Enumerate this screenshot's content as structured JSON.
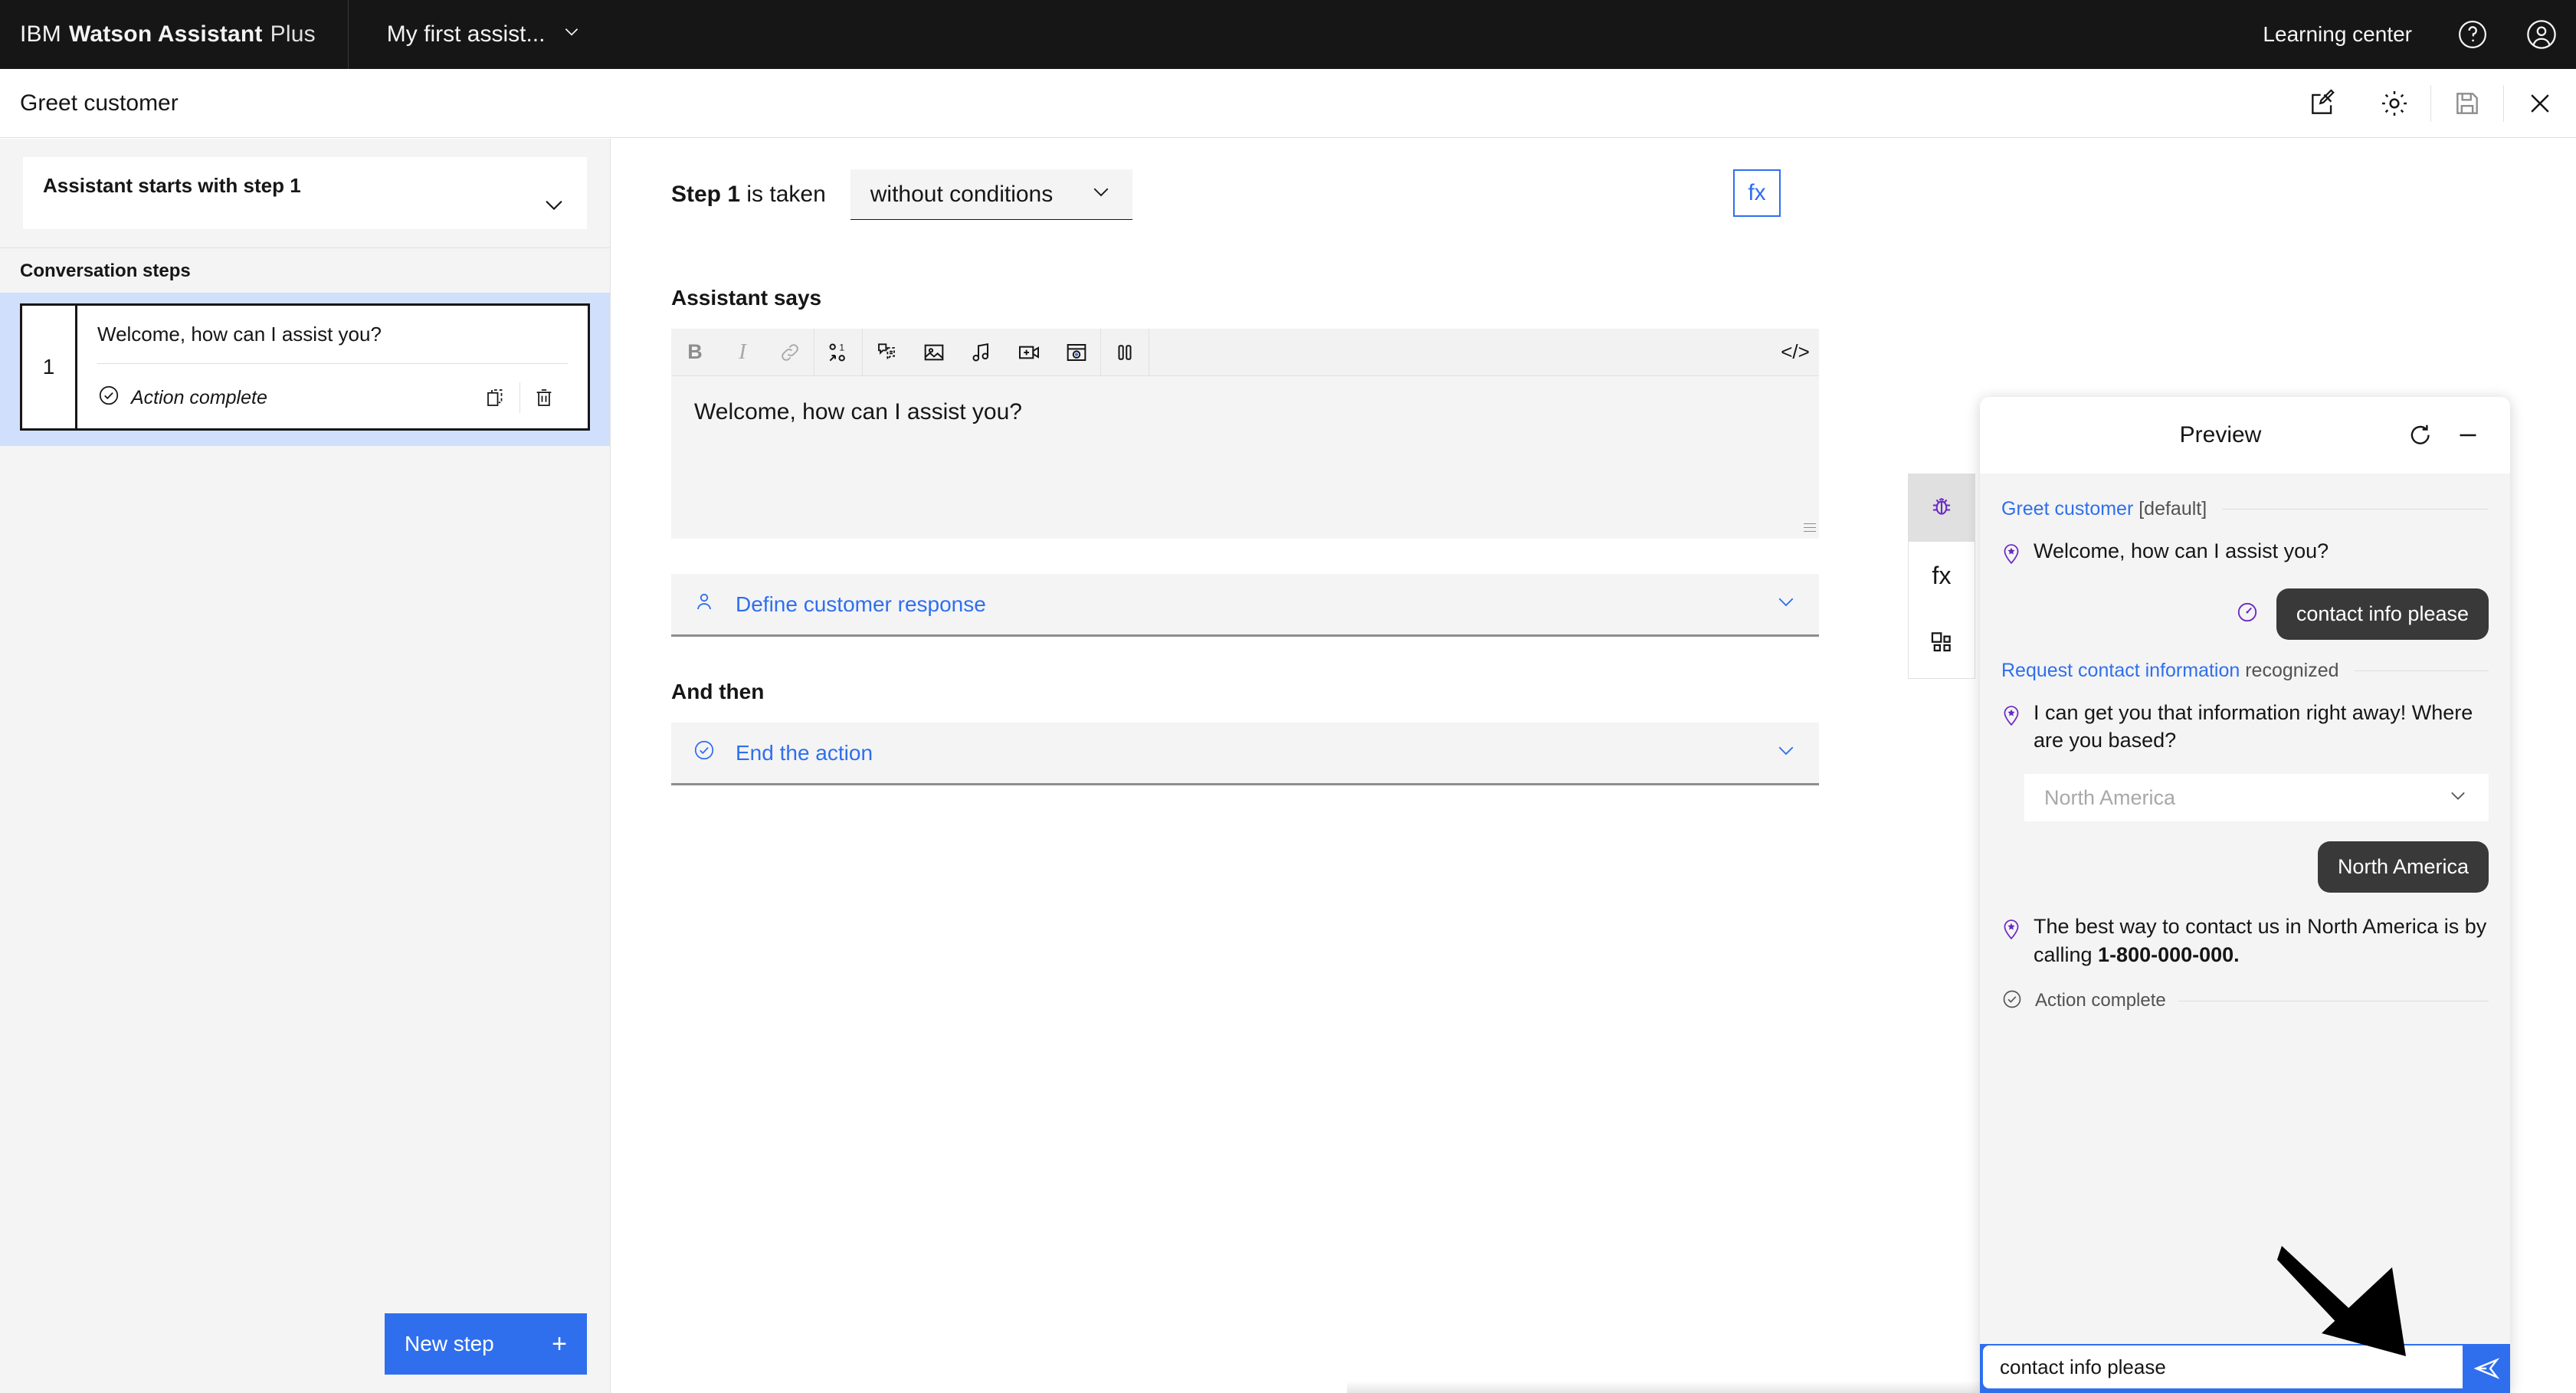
{
  "topbar": {
    "brand_ibm": "IBM",
    "brand_product": "Watson Assistant",
    "brand_tier": "Plus",
    "assistant_name": "My first assist...",
    "learning_center": "Learning center",
    "icons": {
      "help": "help-icon",
      "account": "user-avatar-icon",
      "chevron": "chevron-down-icon"
    }
  },
  "subbar": {
    "title": "Greet customer",
    "icons": {
      "edit": "edit-icon",
      "settings": "gear-icon",
      "save": "save-icon",
      "close": "close-icon"
    }
  },
  "sidebar": {
    "starts_with": "Assistant starts with step 1",
    "steps_heading": "Conversation steps",
    "steps": [
      {
        "number": "1",
        "text": "Welcome, how can I assist you?",
        "status": "Action complete",
        "actions": {
          "duplicate": "duplicate-icon",
          "delete": "trash-icon"
        }
      }
    ],
    "new_step_label": "New step",
    "new_step_plus": "+"
  },
  "main": {
    "step_prefix": "Step 1",
    "step_suffix": " is taken",
    "condition_value": "without conditions",
    "fx_label": "fx",
    "assistant_says_label": "Assistant says",
    "editor_text": "Welcome, how can I assist you?",
    "toolbar_icons": [
      "bold-icon",
      "italic-icon",
      "link-icon",
      "option-icon",
      "chat-note-icon",
      "image-icon",
      "audio-icon",
      "video-icon",
      "iframe-icon",
      "pause-icon",
      "code-icon"
    ],
    "toolbar_labels": {
      "bold": "B",
      "italic": "I",
      "code": "</>"
    },
    "define_response_label": "Define customer response",
    "and_then_label": "And then",
    "end_action_label": "End the action"
  },
  "rail": {
    "tabs": [
      {
        "name": "debug-tab",
        "icon": "bug-icon",
        "active": true
      },
      {
        "name": "variables-tab",
        "icon": "fx-icon",
        "active": false,
        "label": "fx"
      },
      {
        "name": "layout-tab",
        "icon": "grid-icon",
        "active": false
      }
    ]
  },
  "preview": {
    "title": "Preview",
    "icons": {
      "restart": "restart-icon",
      "minimize": "minimize-icon",
      "send": "send-icon"
    },
    "action_header": {
      "link": "Greet customer",
      "muted": " [default]"
    },
    "messages": [
      {
        "role": "bot",
        "text": "Welcome, how can I assist you?"
      },
      {
        "role": "user",
        "text": "contact info please"
      }
    ],
    "recognized_header": {
      "link": "Request contact information",
      "muted": " recognized"
    },
    "message2": {
      "role": "bot",
      "text": "I can get you that information right away! Where are you based?"
    },
    "dropdown_value": "North America",
    "user_reply": "North America",
    "message3_pre": "The best way to contact us in North America is by calling ",
    "message3_bold": "1-800-000-000.",
    "action_complete": "Action complete",
    "input_value": "contact info please"
  },
  "colors": {
    "brand_blue": "#2f6fed",
    "header_black": "#161616",
    "purple": "#6929c4",
    "panel_gray": "#f4f4f4",
    "selected_blue": "#d0dffb"
  }
}
